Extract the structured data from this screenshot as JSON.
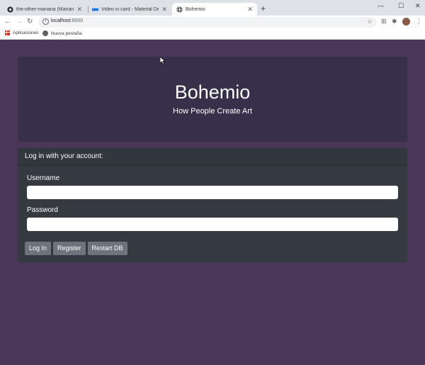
{
  "browser": {
    "tabs": [
      {
        "title": "the-other-mariana (Mariana Ávil",
        "favicon": "github-icon",
        "active": false
      },
      {
        "title": "Video in card - Material Design f",
        "favicon": "material-icon",
        "active": false
      },
      {
        "title": "Bohemio",
        "favicon": "globe-icon",
        "active": true
      }
    ],
    "new_tab": "+",
    "url_host": "localhost",
    "url_port": ":8000",
    "bookmarks": [
      {
        "label": "Aplicaciones",
        "icon": "apps-grid-icon"
      },
      {
        "label": "Nueva pestaña",
        "icon": "globe-icon"
      }
    ]
  },
  "hero": {
    "title": "Bohemio",
    "subtitle": "How People Create Art"
  },
  "login": {
    "header": "Log in with your account:",
    "username_label": "Username",
    "username_value": "",
    "password_label": "Password",
    "password_value": "",
    "buttons": {
      "login": "Log In",
      "register": "Register",
      "restart": "Restart DB"
    }
  },
  "colors": {
    "page_background": "#4a3658",
    "hero_background": "#38304a",
    "card_background": "#343a40",
    "button_background": "#6c757d"
  }
}
